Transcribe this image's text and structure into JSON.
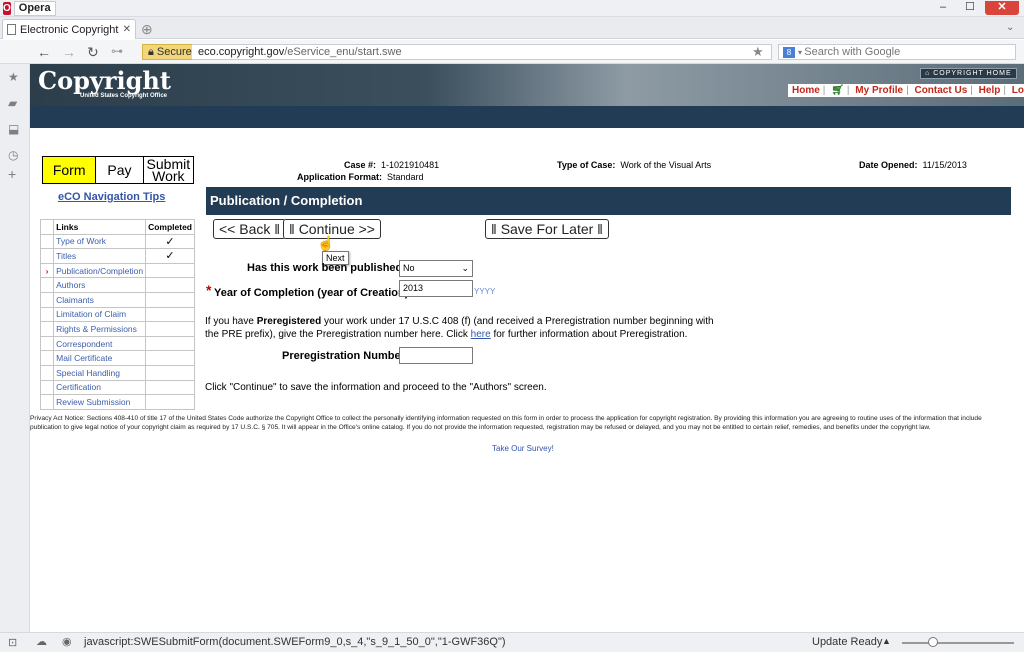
{
  "browser": {
    "app_label": "Opera",
    "tab_title": "Electronic Copyright O...",
    "secure_label": "Secure",
    "url_domain": "eco.copyright.gov",
    "url_path": "/eService_enu/start.swe",
    "search_placeholder": "Search with Google",
    "status_url": "javascript:SWESubmitForm(document.SWEForm9_0,s_4,\"s_9_1_50_0\",\"1-GWF36Q\")",
    "status_ready": "Update Ready"
  },
  "header": {
    "logo": "Copyright",
    "logo_sub": "United States Copyright Office",
    "copyright_home": "COPYRIGHT HOME",
    "links": [
      "Home",
      "My Profile",
      "Contact Us",
      "Help",
      "Log Out"
    ]
  },
  "steps": {
    "form": "Form",
    "pay": "Pay",
    "submit_line1": "Submit",
    "submit_line2": "Work"
  },
  "nav_tips": "eCO Navigation Tips",
  "links_table": {
    "col_links": "Links",
    "col_completed": "Completed",
    "rows": [
      {
        "label": "Type of Work",
        "completed": "✓",
        "current": ""
      },
      {
        "label": "Titles",
        "completed": "✓",
        "current": ""
      },
      {
        "label": "Publication/Completion",
        "completed": "",
        "current": "›"
      },
      {
        "label": "Authors",
        "completed": "",
        "current": ""
      },
      {
        "label": "Claimants",
        "completed": "",
        "current": ""
      },
      {
        "label": "Limitation of Claim",
        "completed": "",
        "current": ""
      },
      {
        "label": "Rights & Permissions",
        "completed": "",
        "current": ""
      },
      {
        "label": "Correspondent",
        "completed": "",
        "current": ""
      },
      {
        "label": "Mail Certificate",
        "completed": "",
        "current": ""
      },
      {
        "label": "Special Handling",
        "completed": "",
        "current": ""
      },
      {
        "label": "Certification",
        "completed": "",
        "current": ""
      },
      {
        "label": "Review Submission",
        "completed": "",
        "current": ""
      }
    ]
  },
  "case": {
    "case_label": "Case #:",
    "case_value": "1-1021910481",
    "format_label": "Application Format:",
    "format_value": "Standard",
    "type_label": "Type of Case:",
    "type_value": "Work of the Visual Arts",
    "opened_label": "Date Opened:",
    "opened_value": "11/15/2013"
  },
  "section_title": "Publication / Completion",
  "buttons": {
    "back": "<< Back",
    "continue": "Continue >>",
    "save_later": "Save For Later",
    "tooltip": "Next"
  },
  "form": {
    "published_label": "Has this work been published?:",
    "published_value": "No",
    "year_required": "*",
    "year_label": "Year of Completion (year of Creation):",
    "year_value": "2013",
    "year_hint": "YYYY",
    "prereg_text_1": "If you have ",
    "prereg_bold": "Preregistered",
    "prereg_text_2": " your work under 17 U.S.C 408 (f) (and received a Preregistration number beginning with",
    "prereg_text_3": "the PRE prefix), give the Preregistration number here. Click ",
    "prereg_link": "here",
    "prereg_text_4": " for further information about Preregistration.",
    "prereg_label": "Preregistration Number:",
    "prereg_value": "",
    "continue_note": "Click \"Continue\" to save the information and proceed to the \"Authors\" screen."
  },
  "privacy": "Privacy Act Notice: Sections 408-410 of title 17 of the United States Code authorize the Copyright Office to collect the personally identifying information requested on this form in order to process the application for copyright registration. By providing this information you are agreeing to routine uses of the information that include publication to give legal notice of your copyright claim as required by 17 U.S.C. § 705. It will appear in the Office's online catalog. If you do not provide the information requested, registration may be refused or delayed, and you may not be entitled to certain relief, remedies, and benefits under the copyright law.",
  "survey": "Take Our Survey!"
}
